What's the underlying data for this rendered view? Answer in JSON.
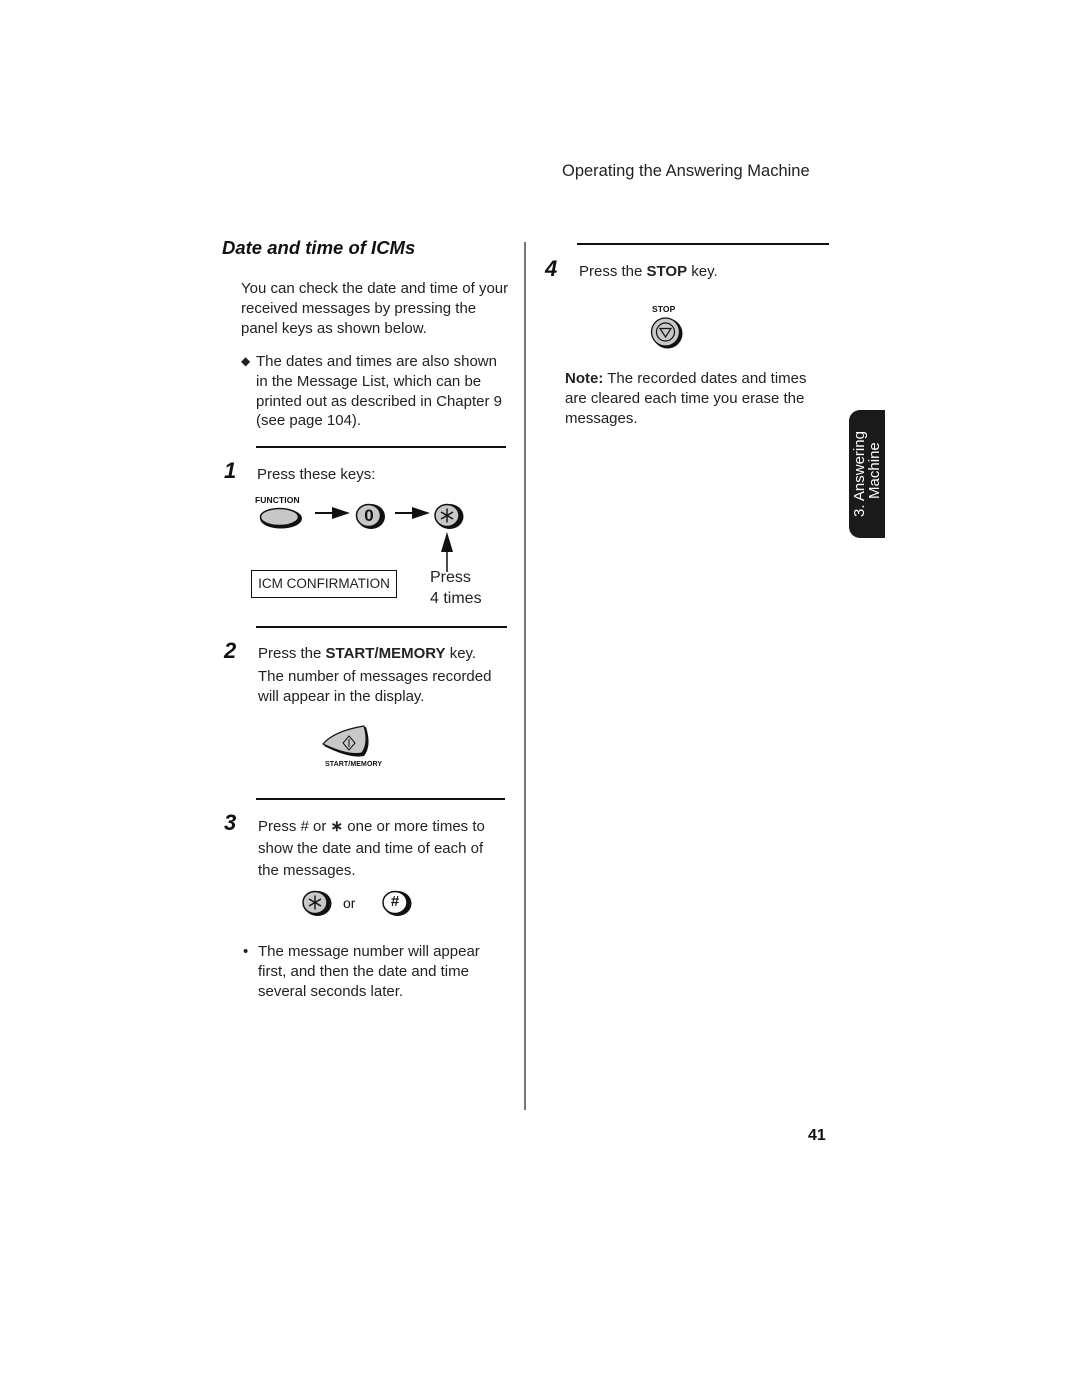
{
  "header": {
    "title": "Operating the Answering Machine"
  },
  "section": {
    "title": "Date and time of ICMs",
    "intro": "You can check the date and time of your received messages by pressing the panel keys as shown below.",
    "bullet_glyph": "◆",
    "bullet": "The dates and times are also shown in the Message List, which can be printed out as described in Chapter 9 (see page 104)."
  },
  "steps": [
    {
      "number": "1",
      "text": "Press these keys:",
      "keys": {
        "function_label": "FUNCTION",
        "zero_key": "0",
        "star_key": "∗"
      },
      "display": "ICM CONFIRMATION",
      "press_note_line1": "Press",
      "press_note_line2": "4 times"
    },
    {
      "number": "2",
      "text_prefix": "Press the ",
      "text_key": "START/MEMORY",
      "text_suffix": " key.",
      "text2": "The number of messages recorded will appear in the display.",
      "key_label": "START/MEMORY"
    },
    {
      "number": "3",
      "text_prefix": "Press # or ",
      "text_star": "∗",
      "text_suffix": " one or more times to show the date and time of each of the messages.",
      "star_key": "∗",
      "or_label": "or",
      "hash_key": "#",
      "bullet_glyph": "•",
      "bullet": "The message number will appear first, and then the date and time several seconds later."
    },
    {
      "number": "4",
      "text_prefix": "Press the ",
      "text_key": "STOP",
      "text_suffix": " key.",
      "key_label": "STOP"
    }
  ],
  "note": {
    "label": "Note:",
    "text": " The recorded dates and times are cleared each time you erase the messages."
  },
  "side_tab": {
    "line1": "3. Answering",
    "line2": "Machine"
  },
  "page_number": "41",
  "colors": {
    "key_fill": "#c8c8c8",
    "tab_bg": "#1a1a1a",
    "text": "#222222"
  }
}
